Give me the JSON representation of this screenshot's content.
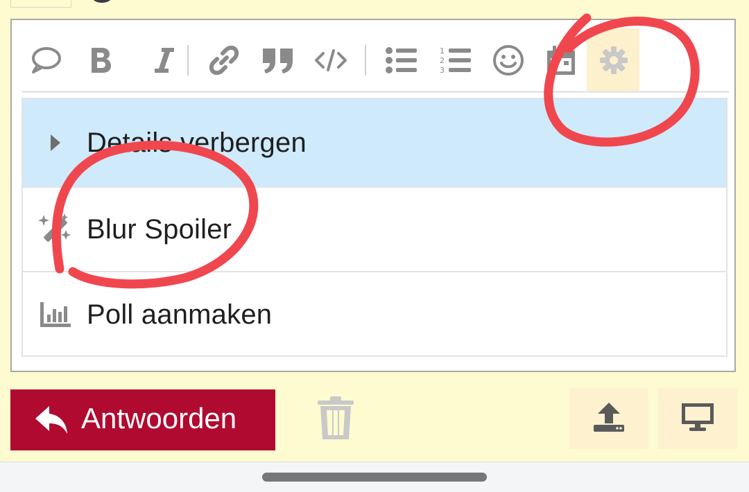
{
  "toolbar": {
    "buttons": [
      {
        "name": "speech-bubble-icon"
      },
      {
        "name": "bold-icon"
      },
      {
        "name": "italic-icon"
      },
      {
        "name": "link-icon"
      },
      {
        "name": "quote-icon"
      },
      {
        "name": "code-icon"
      },
      {
        "name": "bulleted-list-icon"
      },
      {
        "name": "numbered-list-icon"
      },
      {
        "name": "smiley-icon"
      },
      {
        "name": "calendar-icon"
      },
      {
        "name": "gear-icon",
        "active": true
      }
    ]
  },
  "menu": {
    "items": [
      {
        "label": "Details verbergen",
        "icon": "caret-right-icon",
        "highlighted": true
      },
      {
        "label": "Blur Spoiler",
        "icon": "magic-wand-icon"
      },
      {
        "label": "Poll aanmaken",
        "icon": "bar-chart-icon"
      }
    ]
  },
  "actions": {
    "reply_label": "Antwoorden",
    "reply_color": "#b00a31",
    "trash_icon": "trash-icon",
    "upload_icon": "upload-icon",
    "preview_icon": "monitor-icon"
  },
  "colors": {
    "page_background": "#fffbd0",
    "highlight": "#cfeafb",
    "annotation": "#f0474f"
  }
}
